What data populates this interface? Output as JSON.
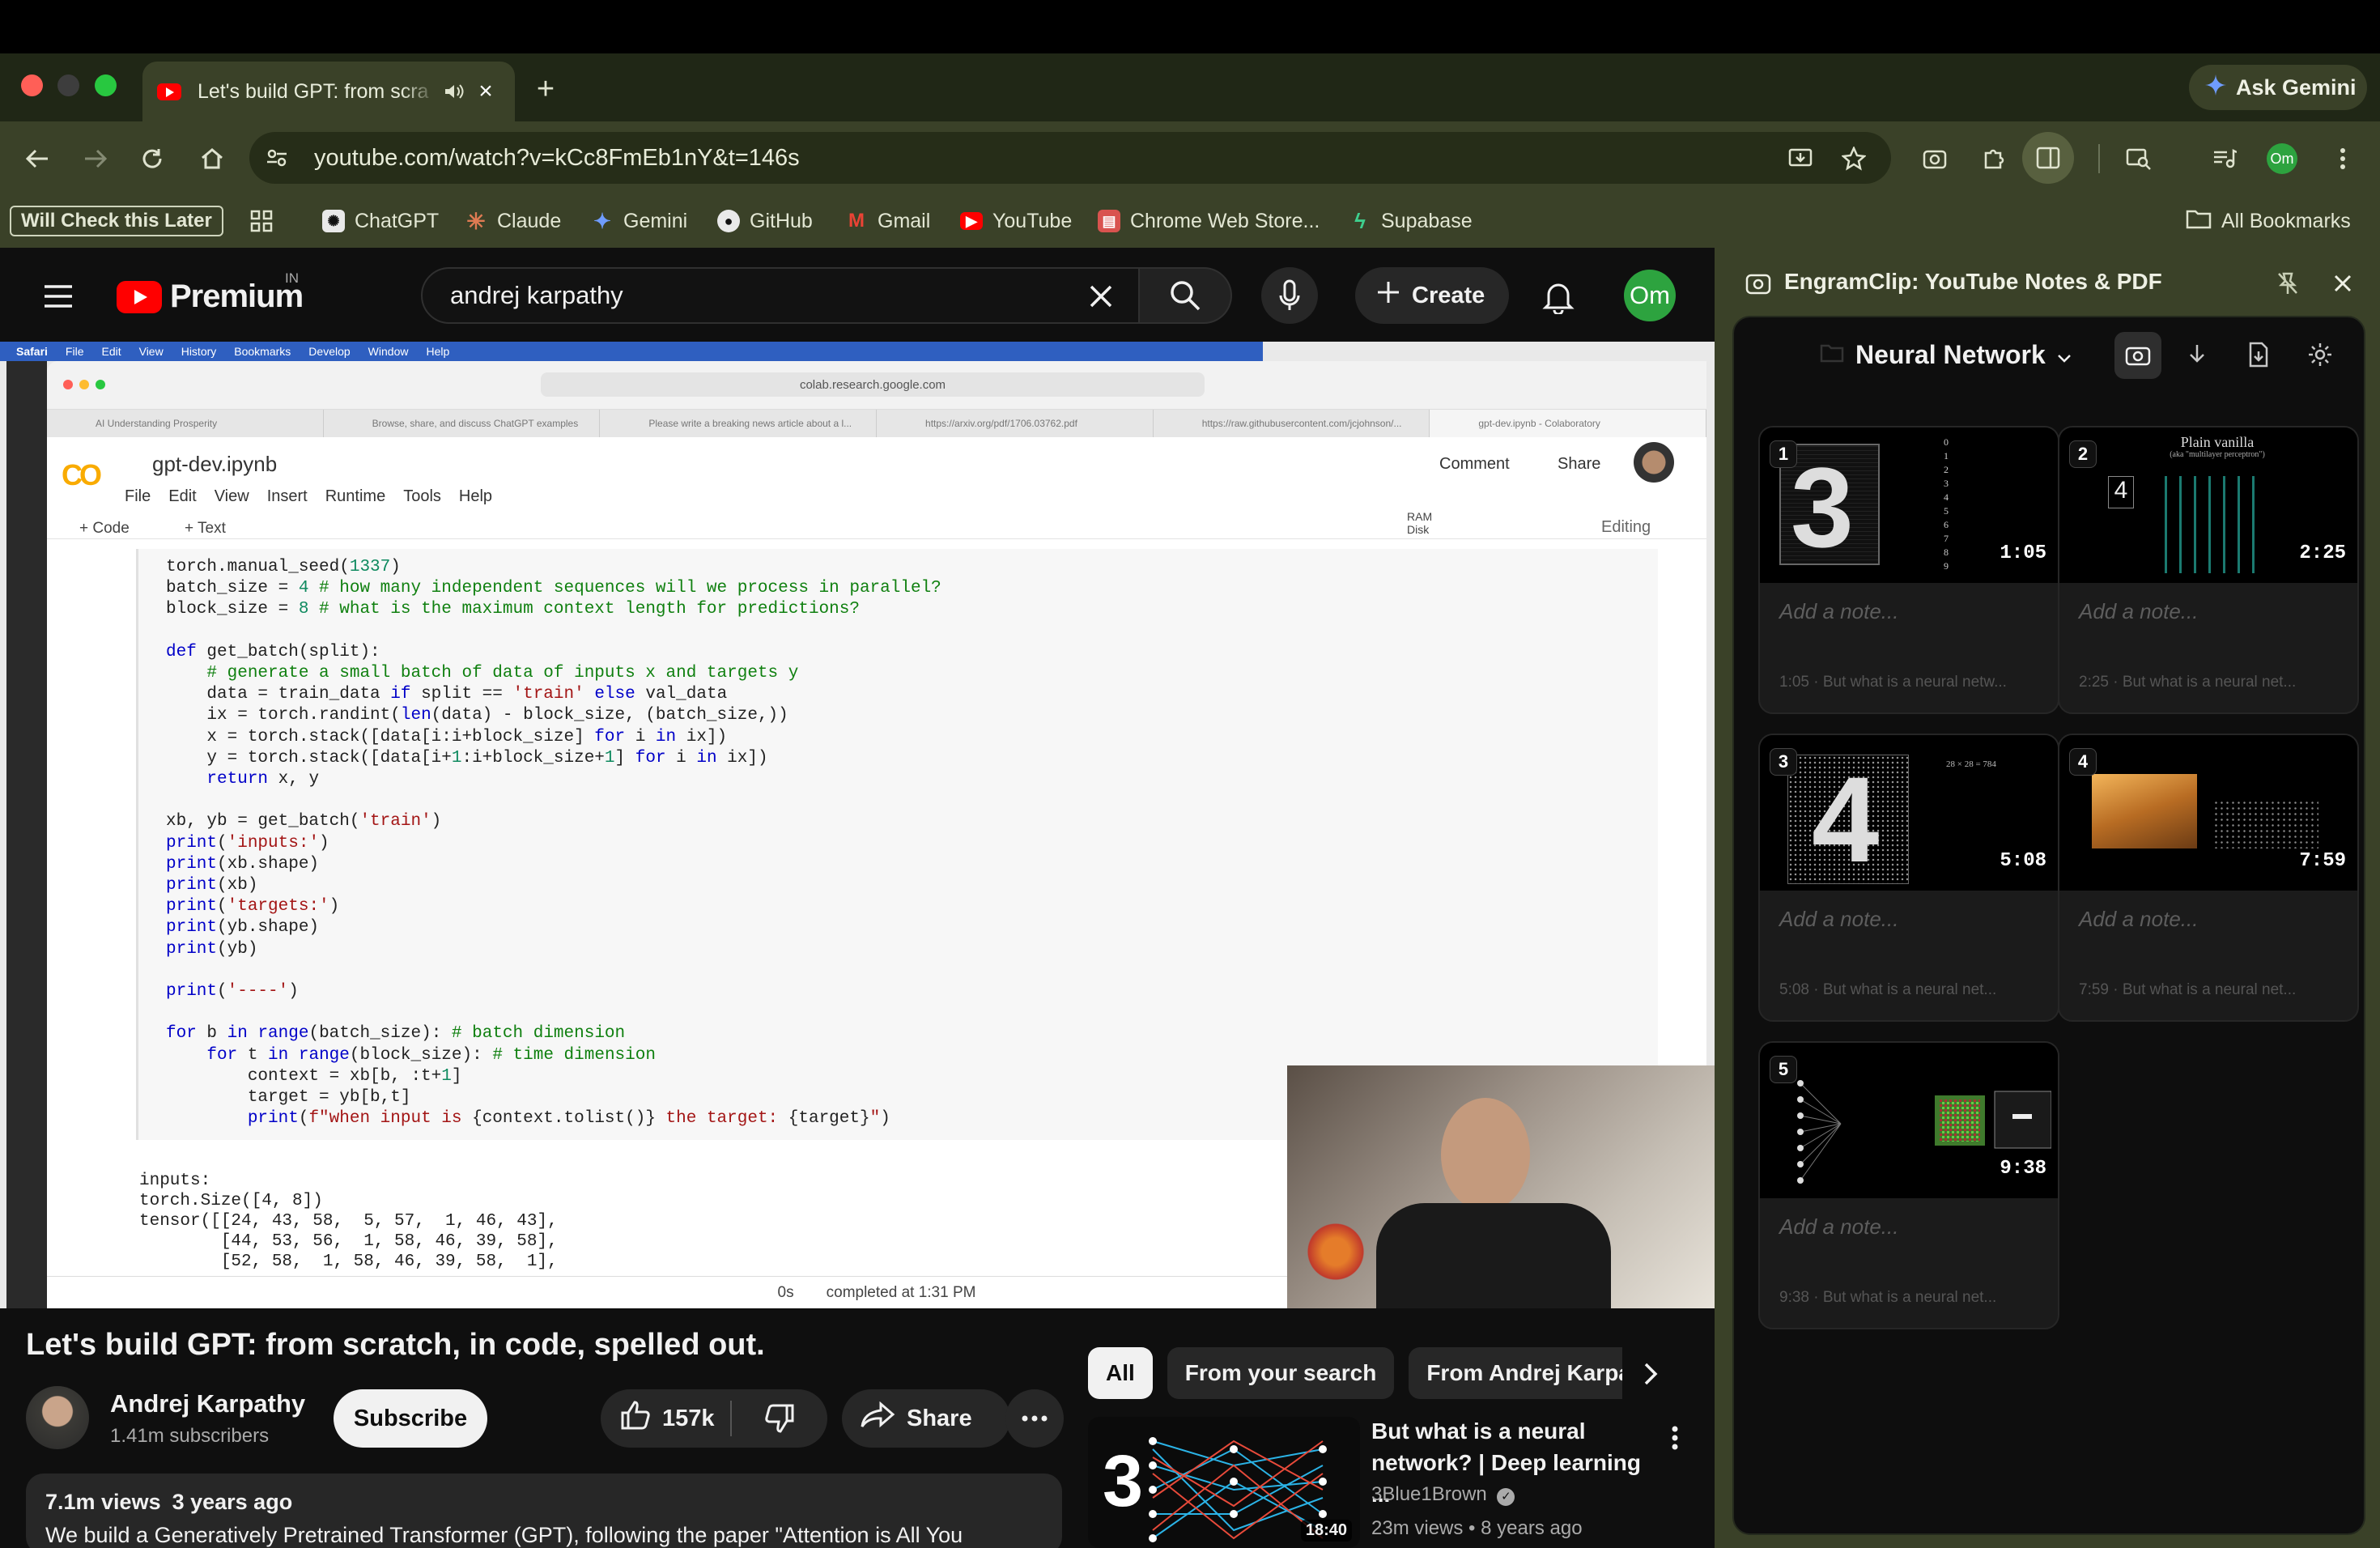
{
  "browser": {
    "tab_title": "Let's build GPT: from scra",
    "url": "youtube.com/watch?v=kCc8FmEb1nY&t=146s",
    "ask_gemini": "Ask Gemini",
    "profile_initials": "Om",
    "bookmarks": [
      "Will Check this Later",
      "ChatGPT",
      "Claude",
      "Gemini",
      "GitHub",
      "Gmail",
      "YouTube",
      "Chrome Web Store...",
      "Supabase"
    ],
    "all_bookmarks": "All Bookmarks"
  },
  "youtube": {
    "logo_text": "Premium",
    "region": "IN",
    "search_value": "andrej karpathy",
    "create_label": "Create",
    "avatar_initials": "Om",
    "video_title": "Let's build GPT: from scratch, in code, spelled out.",
    "channel_name": "Andrej Karpathy",
    "subscribers": "1.41m subscribers",
    "subscribe_label": "Subscribe",
    "likes": "157k",
    "share_label": "Share",
    "views": "7.1m views",
    "age": "3 years ago",
    "description": "We build a Generatively Pretrained Transformer (GPT), following the paper \"Attention is All You",
    "chips": [
      "All",
      "From your search",
      "From Andrej Karpa"
    ],
    "recommended": {
      "title": "But what is a neural network? | Deep learning ...",
      "channel": "3Blue1Brown",
      "views": "23m views",
      "age": "8 years ago",
      "duration": "18:40"
    }
  },
  "video_frame": {
    "mac_menu": [
      "Safari",
      "File",
      "Edit",
      "View",
      "History",
      "Bookmarks",
      "Develop",
      "Window",
      "Help"
    ],
    "safari_url": "colab.research.google.com",
    "safari_tabs": [
      "AI Understanding Prosperity",
      "Browse, share, and discuss ChatGPT examples",
      "Please write a breaking news article about a l...",
      "https://arxiv.org/pdf/1706.03762.pdf",
      "https://raw.githubusercontent.com/jcjohnson/...",
      "gpt-dev.ipynb - Colaboratory"
    ],
    "notebook_title": "gpt-dev.ipynb",
    "menu": [
      "File",
      "Edit",
      "View",
      "Insert",
      "Runtime",
      "Tools",
      "Help"
    ],
    "comment": "Comment",
    "share": "Share",
    "add_code": "+ Code",
    "add_text": "+ Text",
    "ram": "RAM",
    "disk": "Disk",
    "editing": "Editing",
    "output_lines": "inputs:\ntorch.Size([4, 8])\ntensor([[24, 43, 58,  5, 57,  1, 46, 43],\n        [44, 53, 56,  1, 58, 46, 39, 58],\n        [52, 58,  1, 58, 46, 39, 58,  1],",
    "status_time": "0s",
    "status_text": "completed at 1:31 PM"
  },
  "panel": {
    "title": "EngramClip: YouTube Notes & PDF",
    "folder": "Neural Network",
    "note_placeholder": "Add a note...",
    "cards": [
      {
        "num": "1",
        "time": "1:05",
        "source": "1:05 · But what is a neural netw..."
      },
      {
        "num": "2",
        "time": "2:25",
        "source": "2:25 · But what is a neural net...",
        "caption": "Plain vanilla",
        "subcaption": "(aka \"multilayer perceptron\")"
      },
      {
        "num": "3",
        "time": "5:08",
        "source": "5:08 · But what is a neural net...",
        "caption": "28 × 28 = 784"
      },
      {
        "num": "4",
        "time": "7:59",
        "source": "7:59 · But what is a neural net..."
      },
      {
        "num": "5",
        "time": "9:38",
        "source": "9:38 · But what is a neural net..."
      }
    ]
  }
}
